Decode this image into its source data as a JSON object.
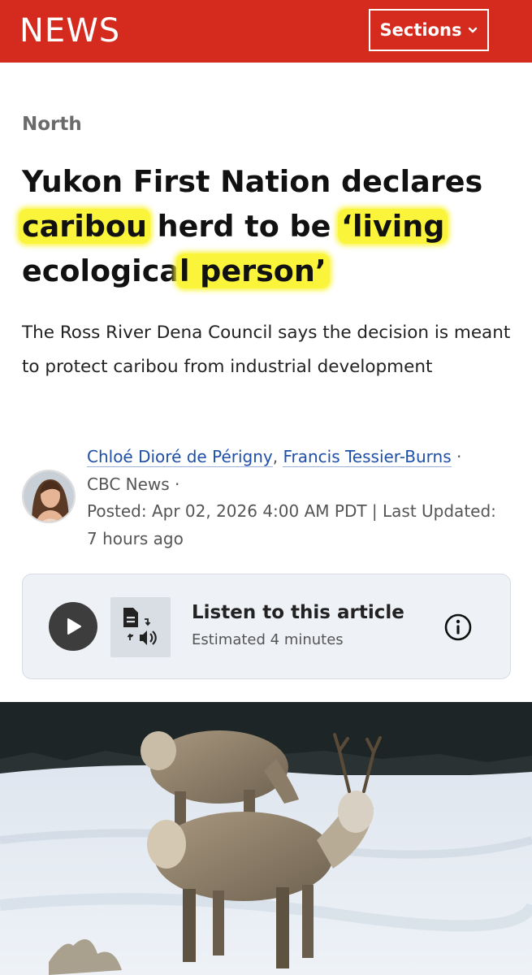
{
  "header": {
    "logo_text": "NEWS",
    "sections_label": "Sections",
    "brand_color": "#d52b1e",
    "chevron_icon": "chevron-down-icon"
  },
  "article": {
    "kicker": "North",
    "headline_parts": {
      "p1": "Yukon First Nation declares ",
      "h1": "caribou",
      "p2": " herd to be ",
      "h2": "‘living",
      "p3": " ecologica",
      "h3": "l person’"
    },
    "highlight_color": "#faf43a",
    "dek": "The Ross River Dena Council says the decision is meant to protect caribou from industrial development",
    "byline": {
      "author1": "Chloé Dioré de Périgny",
      "separator": ",",
      "author2": "Francis Tessier-Burns",
      "dot": " ·",
      "outlet": "CBC News",
      "outlet_dot": " ·",
      "posted": "Posted: Apr 02, 2026 4:00 AM PDT | Last Updated: 7 hours ago"
    }
  },
  "listen": {
    "title": "Listen to this article",
    "subtitle": "Estimated 4 minutes",
    "play_icon": "play-icon",
    "tts_icon": "text-to-speech-icon",
    "info_icon": "info-icon"
  }
}
